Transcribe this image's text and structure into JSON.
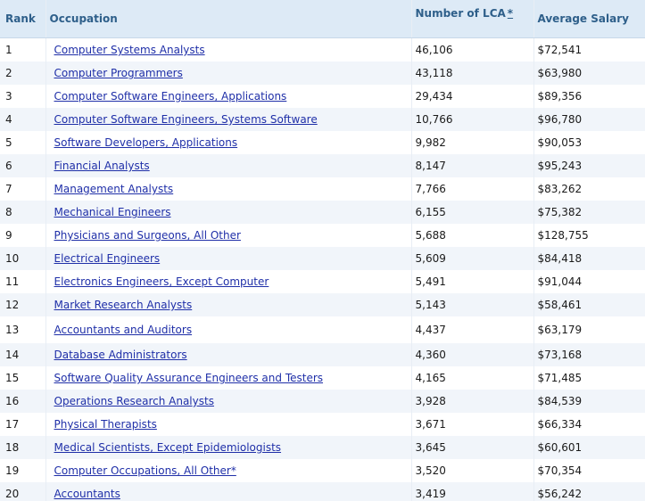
{
  "header": {
    "rank": "Rank",
    "occupation": "Occupation",
    "lca": "Number of LCA",
    "lca_footnote": "*",
    "salary": "Average Salary"
  },
  "rows": [
    {
      "rank": "1",
      "occupation": "Computer Systems Analysts",
      "lca": "46,106",
      "salary": "$72,541"
    },
    {
      "rank": "2",
      "occupation": "Computer Programmers",
      "lca": "43,118",
      "salary": "$63,980"
    },
    {
      "rank": "3",
      "occupation": "Computer Software Engineers, Applications",
      "lca": "29,434",
      "salary": "$89,356"
    },
    {
      "rank": "4",
      "occupation": "Computer Software Engineers, Systems Software",
      "lca": "10,766",
      "salary": "$96,780"
    },
    {
      "rank": "5",
      "occupation": "Software Developers, Applications",
      "lca": "9,982",
      "salary": "$90,053"
    },
    {
      "rank": "6",
      "occupation": "Financial Analysts",
      "lca": "8,147",
      "salary": "$95,243"
    },
    {
      "rank": "7",
      "occupation": "Management Analysts",
      "lca": "7,766",
      "salary": "$83,262"
    },
    {
      "rank": "8",
      "occupation": "Mechanical Engineers",
      "lca": "6,155",
      "salary": "$75,382"
    },
    {
      "rank": "9",
      "occupation": "Physicians and Surgeons, All Other",
      "lca": "5,688",
      "salary": "$128,755"
    },
    {
      "rank": "10",
      "occupation": "Electrical Engineers",
      "lca": "5,609",
      "salary": "$84,418"
    },
    {
      "rank": "11",
      "occupation": "Electronics Engineers, Except Computer",
      "lca": "5,491",
      "salary": "$91,044"
    },
    {
      "rank": "12",
      "occupation": "Market Research Analysts",
      "lca": "5,143",
      "salary": "$58,461"
    },
    {
      "rank": "13",
      "occupation": "Accountants and Auditors",
      "lca": "4,437",
      "salary": "$63,179"
    },
    {
      "rank": "14",
      "occupation": "Database Administrators",
      "lca": "4,360",
      "salary": "$73,168"
    },
    {
      "rank": "15",
      "occupation": "Software Quality Assurance Engineers and Testers",
      "lca": "4,165",
      "salary": "$71,485"
    },
    {
      "rank": "16",
      "occupation": "Operations Research Analysts",
      "lca": "3,928",
      "salary": "$84,539"
    },
    {
      "rank": "17",
      "occupation": "Physical Therapists",
      "lca": "3,671",
      "salary": "$66,334"
    },
    {
      "rank": "18",
      "occupation": "Medical Scientists, Except Epidemiologists",
      "lca": "3,645",
      "salary": "$60,601"
    },
    {
      "rank": "19",
      "occupation": "Computer Occupations, All Other*",
      "lca": "3,520",
      "salary": "$70,354"
    },
    {
      "rank": "20",
      "occupation": "Accountants",
      "lca": "3,419",
      "salary": "$56,242"
    }
  ]
}
